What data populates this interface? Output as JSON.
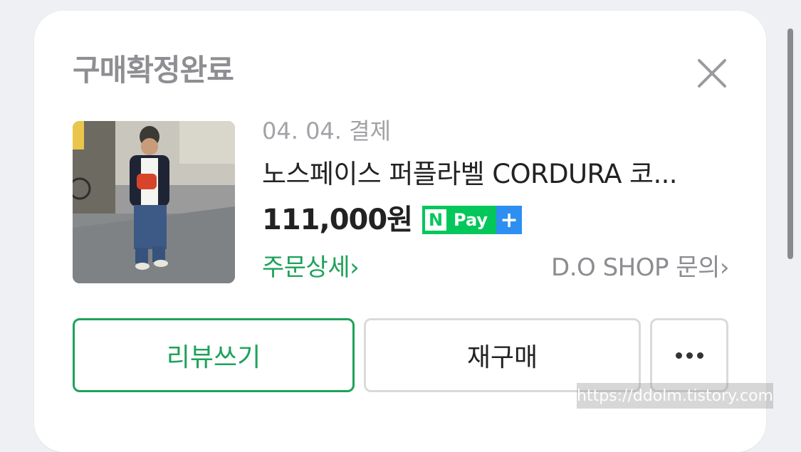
{
  "header": {
    "title": "구매확정완료",
    "close_icon": "close-icon"
  },
  "order": {
    "date": "04. 04. 결제",
    "product_name": "노스페이스 퍼플라벨 CORDURA 코...",
    "price": "111,000원",
    "npay": {
      "n_label": "N",
      "pay_label": "Pay",
      "plus_label": "+"
    },
    "order_detail_label": "주문상세",
    "shop_inquiry_label": "D.O SHOP 문의",
    "chevron": "›"
  },
  "actions": {
    "review_label": "리뷰쓰기",
    "rebuy_label": "재구매",
    "more_icon": "more-dots-icon"
  },
  "watermark": "https://ddolm.tistory.com",
  "colors": {
    "accent_green": "#1ea25a",
    "npay_green": "#03c75a",
    "npay_blue": "#2e8ff2",
    "title_gray": "#8e8e93"
  }
}
